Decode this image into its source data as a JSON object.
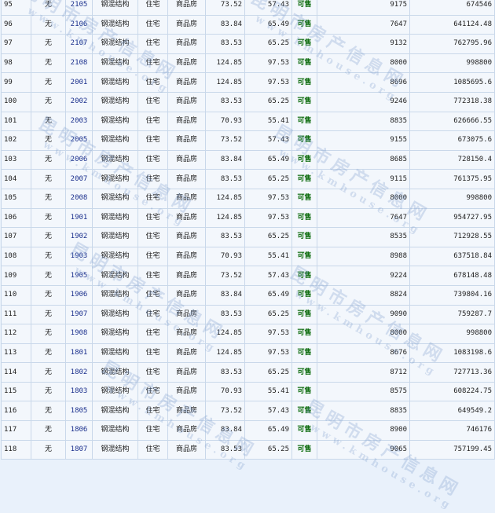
{
  "watermark": {
    "cn": "昆明市房产信息网",
    "en": "www.kmhouse.org"
  },
  "rows": [
    [
      "95",
      "无",
      "2105",
      "钢混结构",
      "住宅",
      "商品房",
      "73.52",
      "57.43",
      "可售",
      "9175",
      "674546"
    ],
    [
      "96",
      "无",
      "2106",
      "钢混结构",
      "住宅",
      "商品房",
      "83.84",
      "65.49",
      "可售",
      "7647",
      "641124.48"
    ],
    [
      "97",
      "无",
      "2107",
      "钢混结构",
      "住宅",
      "商品房",
      "83.53",
      "65.25",
      "可售",
      "9132",
      "762795.96"
    ],
    [
      "98",
      "无",
      "2108",
      "钢混结构",
      "住宅",
      "商品房",
      "124.85",
      "97.53",
      "可售",
      "8000",
      "998800"
    ],
    [
      "99",
      "无",
      "2001",
      "钢混结构",
      "住宅",
      "商品房",
      "124.85",
      "97.53",
      "可售",
      "8696",
      "1085695.6"
    ],
    [
      "100",
      "无",
      "2002",
      "钢混结构",
      "住宅",
      "商品房",
      "83.53",
      "65.25",
      "可售",
      "9246",
      "772318.38"
    ],
    [
      "101",
      "无",
      "2003",
      "钢混结构",
      "住宅",
      "商品房",
      "70.93",
      "55.41",
      "可售",
      "8835",
      "626666.55"
    ],
    [
      "102",
      "无",
      "2005",
      "钢混结构",
      "住宅",
      "商品房",
      "73.52",
      "57.43",
      "可售",
      "9155",
      "673075.6"
    ],
    [
      "103",
      "无",
      "2006",
      "钢混结构",
      "住宅",
      "商品房",
      "83.84",
      "65.49",
      "可售",
      "8685",
      "728150.4"
    ],
    [
      "104",
      "无",
      "2007",
      "钢混结构",
      "住宅",
      "商品房",
      "83.53",
      "65.25",
      "可售",
      "9115",
      "761375.95"
    ],
    [
      "105",
      "无",
      "2008",
      "钢混结构",
      "住宅",
      "商品房",
      "124.85",
      "97.53",
      "可售",
      "8000",
      "998800"
    ],
    [
      "106",
      "无",
      "1901",
      "钢混结构",
      "住宅",
      "商品房",
      "124.85",
      "97.53",
      "可售",
      "7647",
      "954727.95"
    ],
    [
      "107",
      "无",
      "1902",
      "钢混结构",
      "住宅",
      "商品房",
      "83.53",
      "65.25",
      "可售",
      "8535",
      "712928.55"
    ],
    [
      "108",
      "无",
      "1903",
      "钢混结构",
      "住宅",
      "商品房",
      "70.93",
      "55.41",
      "可售",
      "8988",
      "637518.84"
    ],
    [
      "109",
      "无",
      "1905",
      "钢混结构",
      "住宅",
      "商品房",
      "73.52",
      "57.43",
      "可售",
      "9224",
      "678148.48"
    ],
    [
      "110",
      "无",
      "1906",
      "钢混结构",
      "住宅",
      "商品房",
      "83.84",
      "65.49",
      "可售",
      "8824",
      "739804.16"
    ],
    [
      "111",
      "无",
      "1907",
      "钢混结构",
      "住宅",
      "商品房",
      "83.53",
      "65.25",
      "可售",
      "9090",
      "759287.7"
    ],
    [
      "112",
      "无",
      "1908",
      "钢混结构",
      "住宅",
      "商品房",
      "124.85",
      "97.53",
      "可售",
      "8000",
      "998800"
    ],
    [
      "113",
      "无",
      "1801",
      "钢混结构",
      "住宅",
      "商品房",
      "124.85",
      "97.53",
      "可售",
      "8676",
      "1083198.6"
    ],
    [
      "114",
      "无",
      "1802",
      "钢混结构",
      "住宅",
      "商品房",
      "83.53",
      "65.25",
      "可售",
      "8712",
      "727713.36"
    ],
    [
      "115",
      "无",
      "1803",
      "钢混结构",
      "住宅",
      "商品房",
      "70.93",
      "55.41",
      "可售",
      "8575",
      "608224.75"
    ],
    [
      "116",
      "无",
      "1805",
      "钢混结构",
      "住宅",
      "商品房",
      "73.52",
      "57.43",
      "可售",
      "8835",
      "649549.2"
    ],
    [
      "117",
      "无",
      "1806",
      "钢混结构",
      "住宅",
      "商品房",
      "83.84",
      "65.49",
      "可售",
      "8900",
      "746176"
    ],
    [
      "118",
      "无",
      "1807",
      "钢混结构",
      "住宅",
      "商品房",
      "83.53",
      "65.25",
      "可售",
      "9065",
      "757199.45"
    ]
  ]
}
